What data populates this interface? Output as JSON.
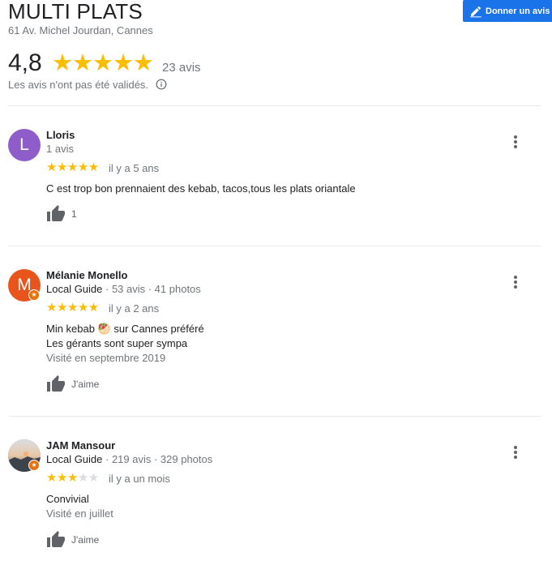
{
  "place": {
    "title": "MULTI PLATS",
    "address": "61 Av. Michel Jourdan, Cannes",
    "rating": "4,8",
    "stars": "★★★★★",
    "review_count": "23 avis",
    "disclaimer": "Les avis n'ont pas été validés.",
    "write_review_label": "Donner un avis"
  },
  "reviews": [
    {
      "initial": "L",
      "avatar_color": "#8e5dc9",
      "name": "Lloris",
      "meta": "1 avis",
      "stars_on": "★★★★★",
      "stars_off": "",
      "when": "il y a 5 ans",
      "text": [
        "C est trop bon prennaient des kebab, tacos,tous les plats oriantale"
      ],
      "visited": "",
      "likes": "1"
    },
    {
      "initial": "M",
      "avatar_color": "#e8541b",
      "name": "Mélanie Monello",
      "local_guide": "Local Guide",
      "meta": " · 53 avis · 41 photos",
      "stars_on": "★★★★★",
      "stars_off": "",
      "when": "il y a 2 ans",
      "text": [
        "Min kebab 🥙 sur Cannes préféré",
        "Les gérants sont super sympa"
      ],
      "visited": "Visité en septembre 2019",
      "likes": "J'aime"
    },
    {
      "initial": "",
      "avatar_color": "#6b6f76",
      "name": "JAM Mansour",
      "local_guide": "Local Guide",
      "meta": " · 219 avis · 329 photos",
      "stars_on": "★★★",
      "stars_off": "★★",
      "when": "il y a un mois",
      "text": [
        "Convivial"
      ],
      "visited": "Visité en juillet",
      "likes": "J'aime"
    }
  ],
  "colors": {
    "accent": "#1a73e8",
    "star": "#fbbc04",
    "local_guide_badge": "#e8710a"
  },
  "icons": [
    "pencil-icon",
    "info-icon",
    "thumbs-up-icon",
    "more-vert-icon",
    "local-guide-badge-icon"
  ]
}
